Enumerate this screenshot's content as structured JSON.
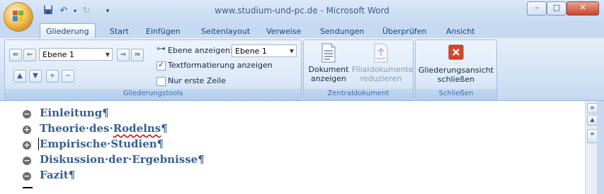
{
  "window": {
    "title": "www.studium-und-pc.de - Microsoft Word",
    "controls": {
      "minimize": "–",
      "maximize": "□",
      "close": "✕"
    }
  },
  "quick_access": {
    "save_icon": "save-icon",
    "undo_icon": "undo-icon",
    "redo_icon": "redo-icon",
    "customize_icon": "customize-icon"
  },
  "tabs": [
    "Gliederung",
    "Start",
    "Einfügen",
    "Seitenlayout",
    "Verweise",
    "Sendungen",
    "Überprüfen",
    "Ansicht"
  ],
  "active_tab": "Gliederung",
  "help": "?",
  "ribbon": {
    "outline_tools": {
      "label": "Gliederungstools",
      "level_value": "Ebene 1",
      "show_level_label": "Ebene anzeigen:",
      "show_level_value": "Ebene 1",
      "show_text_formatting": "Textformatierung anzeigen",
      "show_text_formatting_checked": true,
      "show_first_line_only": "Nur erste Zeile",
      "show_first_line_only_checked": false
    },
    "master_document": {
      "label": "Zentraldokument",
      "show_document": [
        "Dokument",
        "anzeigen"
      ],
      "collapse_subdocuments": [
        "Filialdokumente",
        "reduzieren"
      ]
    },
    "close": {
      "label": "Schließen",
      "close_outline_view": [
        "Gliederungsansicht",
        "schließen"
      ]
    }
  },
  "document": {
    "headings": [
      {
        "text": "Einleitung",
        "expanded": false,
        "symbol": "−"
      },
      {
        "text": "Theorie·des·Rodelns",
        "expanded": true,
        "symbol": "+",
        "spellcheck": "Rodelns"
      },
      {
        "text": "Empirische·Studien",
        "expanded": true,
        "symbol": "+"
      },
      {
        "text": "Diskussion·der·Ergebnisse",
        "expanded": false,
        "symbol": "−"
      },
      {
        "text": "Fazit",
        "expanded": false,
        "symbol": "−"
      }
    ],
    "pilcrow": "¶"
  },
  "colors": {
    "heading": "#365f91",
    "ribbon": "#dbe8f8",
    "accent": "#15428b",
    "close_red": "#c9462c"
  }
}
